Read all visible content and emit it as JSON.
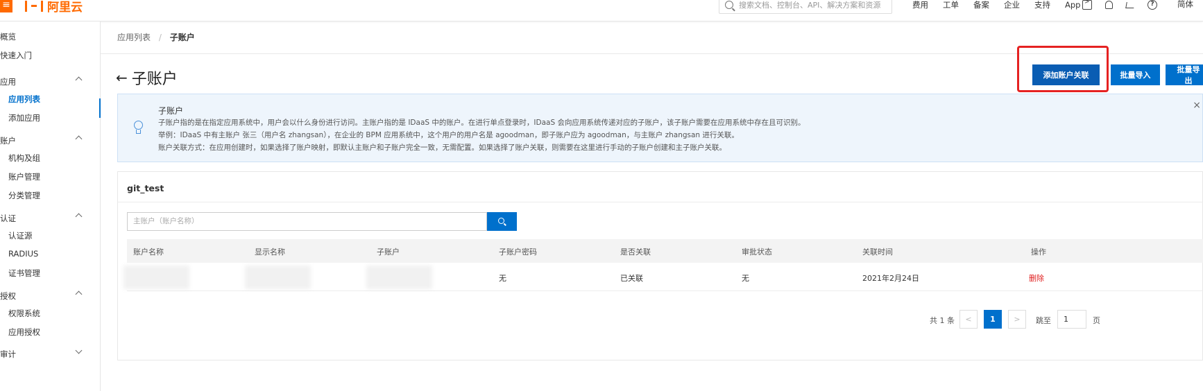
{
  "topbar": {
    "brand": "阿里云",
    "search_placeholder": "搜索文档、控制台、API、解决方案和资源",
    "nav": [
      "费用",
      "工单",
      "备案",
      "企业",
      "支持",
      "App"
    ],
    "lang": "简体"
  },
  "sidebar": {
    "items": [
      {
        "label": "概览",
        "type": "item"
      },
      {
        "label": "快速入门",
        "type": "item"
      },
      {
        "label": "应用",
        "type": "group"
      },
      {
        "label": "应用列表",
        "type": "sub",
        "active": true
      },
      {
        "label": "添加应用",
        "type": "sub"
      },
      {
        "label": "账户",
        "type": "group"
      },
      {
        "label": "机构及组",
        "type": "sub"
      },
      {
        "label": "账户管理",
        "type": "sub"
      },
      {
        "label": "分类管理",
        "type": "sub"
      },
      {
        "label": "认证",
        "type": "group"
      },
      {
        "label": "认证源",
        "type": "sub"
      },
      {
        "label": "RADIUS",
        "type": "sub"
      },
      {
        "label": "证书管理",
        "type": "sub"
      },
      {
        "label": "授权",
        "type": "group"
      },
      {
        "label": "权限系统",
        "type": "sub"
      },
      {
        "label": "应用授权",
        "type": "sub"
      },
      {
        "label": "审计",
        "type": "group"
      }
    ]
  },
  "breadcrumb": {
    "parent": "应用列表",
    "separator": "/",
    "current": "子账户"
  },
  "page": {
    "title": "子账户",
    "back_icon": "arrow-left-icon"
  },
  "actions": {
    "add": "添加账户关联",
    "import": "批量导入",
    "export": "批量导出"
  },
  "notice": {
    "title": "子账户",
    "lines": [
      "子账户指的是在指定应用系统中，用户会以什么身份进行访问。主账户指的是 IDaaS 中的账户。在进行单点登录时，IDaaS 会向应用系统传递对应的子账户，该子账户需要在应用系统中存在且可识别。",
      "举例：IDaaS 中有主账户 张三（用户名 zhangsan），在企业的 BPM 应用系统中，这个用户的用户名是 agoodman，即子账户应为 agoodman，与主账户 zhangsan 进行关联。",
      "账户关联方式：在应用创建时，如果选择了账户映射，即默认主账户和子账户完全一致，无需配置。如果选择了账户关联，则需要在这里进行手动的子账户创建和主子账户关联。"
    ],
    "close": "×"
  },
  "panel": {
    "title": "git_test",
    "search_placeholder": "主账户（账户名称）",
    "columns": [
      "账户名称",
      "显示名称",
      "子账户",
      "子账户密码",
      "是否关联",
      "审批状态",
      "关联时间",
      "操作"
    ],
    "rows": [
      {
        "account": "",
        "display": "",
        "sub": "",
        "password": "无",
        "linked": "已关联",
        "approval": "无",
        "time": "2021年2月24日",
        "op": "删除"
      }
    ],
    "pagination": {
      "total": "共 1 条",
      "prev": "<",
      "current": "1",
      "next": ">",
      "jump_label": "跳至",
      "jump_value": "1",
      "page_label": "页"
    }
  }
}
